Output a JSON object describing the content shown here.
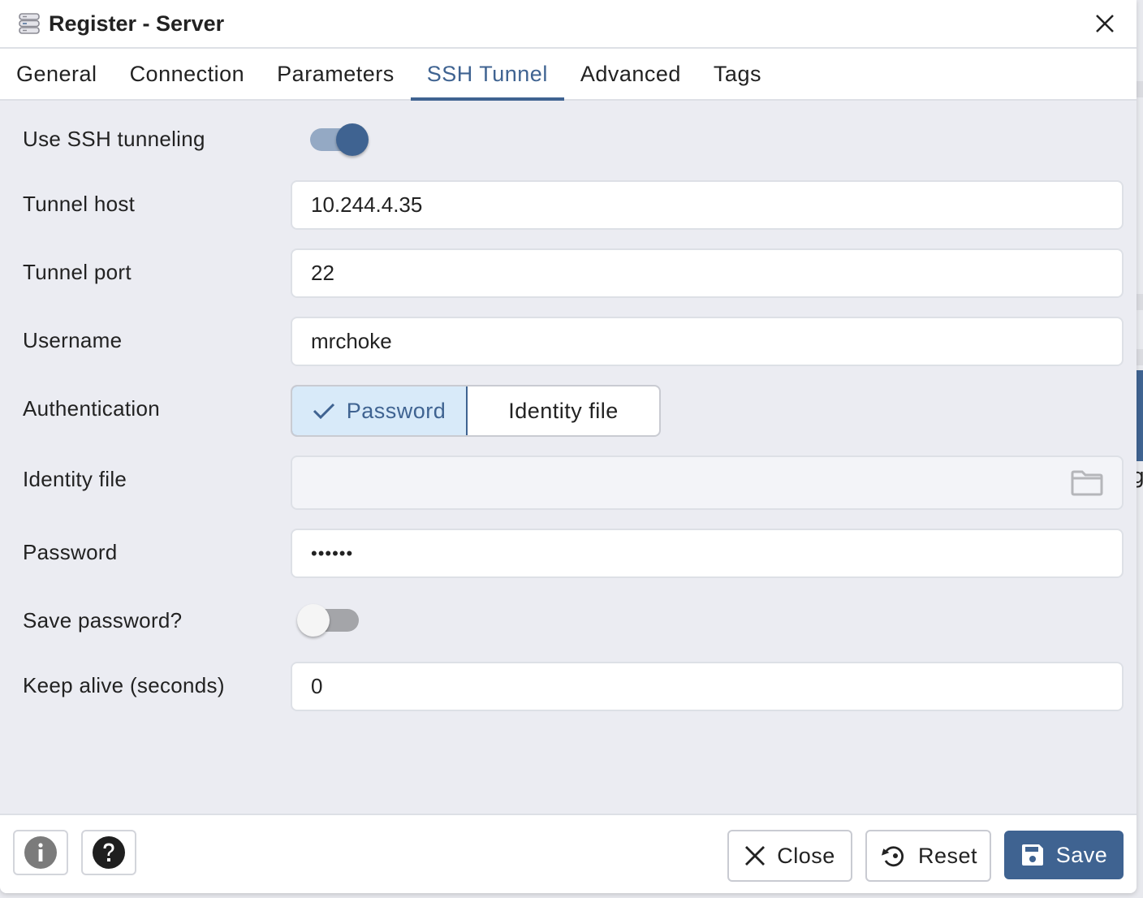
{
  "dialog": {
    "title": "Register - Server",
    "icons": {
      "title": "server-icon",
      "close": "close-icon"
    }
  },
  "tabs": [
    {
      "label": "General",
      "active": false
    },
    {
      "label": "Connection",
      "active": false
    },
    {
      "label": "Parameters",
      "active": false
    },
    {
      "label": "SSH Tunnel",
      "active": true
    },
    {
      "label": "Advanced",
      "active": false
    },
    {
      "label": "Tags",
      "active": false
    }
  ],
  "form": {
    "use_ssh_tunneling": {
      "label": "Use SSH tunneling",
      "value": true
    },
    "tunnel_host": {
      "label": "Tunnel host",
      "value": "10.244.4.35"
    },
    "tunnel_port": {
      "label": "Tunnel port",
      "value": "22"
    },
    "username": {
      "label": "Username",
      "value": "mrchoke"
    },
    "authentication": {
      "label": "Authentication",
      "options": [
        "Password",
        "Identity file"
      ],
      "selected": "Password"
    },
    "identity_file": {
      "label": "Identity file",
      "value": "",
      "icon": "folder-icon"
    },
    "password": {
      "label": "Password",
      "value": "••••••"
    },
    "save_password": {
      "label": "Save password?",
      "value": false
    },
    "keep_alive": {
      "label": "Keep alive (seconds)",
      "value": "0"
    }
  },
  "footer": {
    "info_icon": "info-icon",
    "help_icon": "help-icon",
    "close_label": "Close",
    "reset_label": "Reset",
    "save_label": "Save"
  },
  "colors": {
    "accent": "#3f6391",
    "selected_bg": "#d8eaf9",
    "panel_bg": "#ebecf2",
    "toggle_off_track": "#a4a5a9"
  }
}
